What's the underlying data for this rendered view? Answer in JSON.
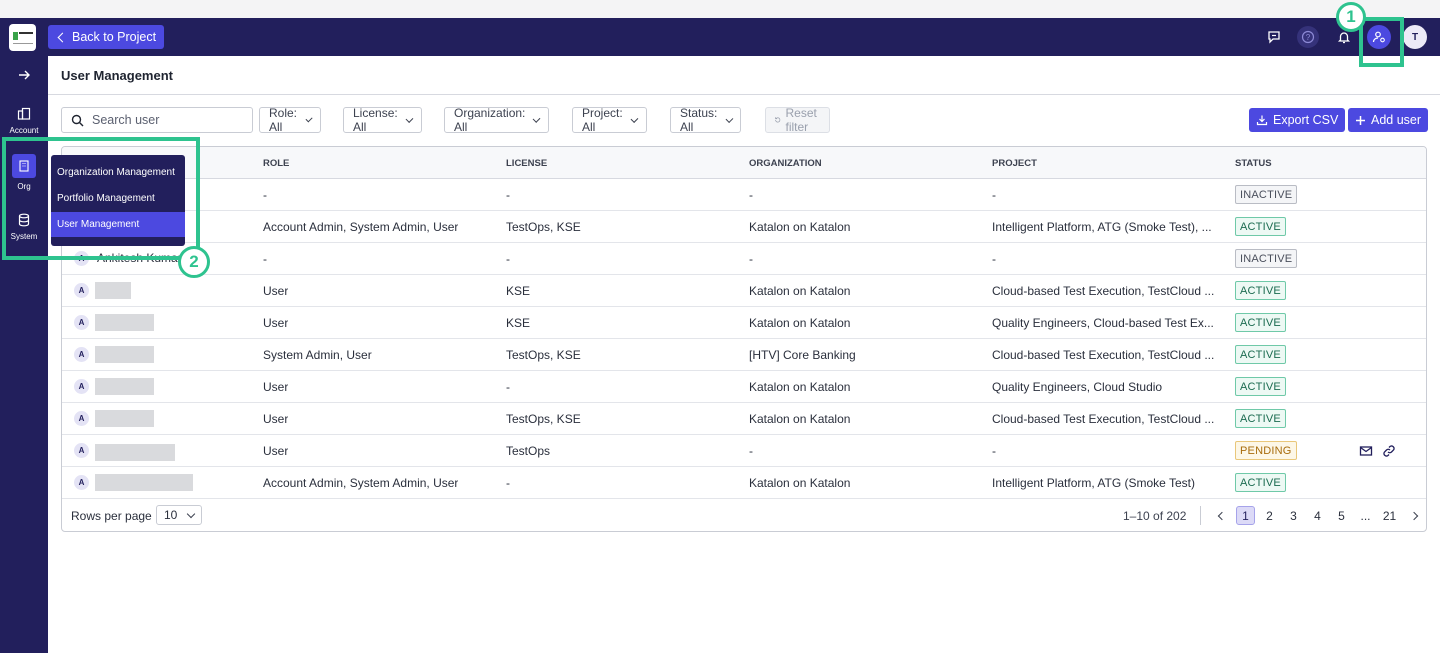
{
  "topbar": {
    "back_label": "Back to Project",
    "user_avatar_initial": "T"
  },
  "sidebar": {
    "items": [
      {
        "label": "Account"
      },
      {
        "label": "Org"
      },
      {
        "label": "System"
      }
    ]
  },
  "org_menu": {
    "items": [
      {
        "label": "Organization Management",
        "selected": false
      },
      {
        "label": "Portfolio Management",
        "selected": false
      },
      {
        "label": "User Management",
        "selected": true
      }
    ]
  },
  "page": {
    "title": "User Management"
  },
  "filters": {
    "search_placeholder": "Search user",
    "role": "Role: All",
    "license": "License: All",
    "organization": "Organization: All",
    "project": "Project: All",
    "status": "Status: All",
    "reset": "Reset filter"
  },
  "actions": {
    "export_label": "Export CSV",
    "add_user_label": "Add user"
  },
  "table": {
    "headers": [
      "ROLE",
      "LICENSE",
      "ORGANIZATION",
      "PROJECT",
      "STATUS"
    ],
    "rows": [
      {
        "avatar": "",
        "name": "",
        "role": "-",
        "license": "-",
        "organization": "-",
        "project": "-",
        "status": "INACTIVE"
      },
      {
        "avatar": "",
        "name": "",
        "role": "Account Admin, System Admin, User",
        "license": "TestOps, KSE",
        "organization": "Katalon on Katalon",
        "project": "Intelligent Platform, ATG (Smoke Test), ...",
        "status": "ACTIVE"
      },
      {
        "avatar": "A",
        "name": "Ankitesh Kumar",
        "role": "-",
        "license": "-",
        "organization": "-",
        "project": "-",
        "status": "INACTIVE"
      },
      {
        "avatar": "A",
        "name": "",
        "role": "User",
        "license": "KSE",
        "organization": "Katalon on Katalon",
        "project": "Cloud-based Test Execution, TestCloud ...",
        "status": "ACTIVE"
      },
      {
        "avatar": "A",
        "name": "",
        "role": "User",
        "license": "KSE",
        "organization": "Katalon on Katalon",
        "project": "Quality Engineers, Cloud-based Test Ex...",
        "status": "ACTIVE"
      },
      {
        "avatar": "A",
        "name": "",
        "role": "System Admin, User",
        "license": "TestOps, KSE",
        "organization": "[HTV] Core Banking",
        "project": "Cloud-based Test Execution, TestCloud ...",
        "status": "ACTIVE"
      },
      {
        "avatar": "A",
        "name": "",
        "role": "User",
        "license": "-",
        "organization": "Katalon on Katalon",
        "project": "Quality Engineers, Cloud Studio",
        "status": "ACTIVE"
      },
      {
        "avatar": "A",
        "name": "",
        "role": "User",
        "license": "TestOps, KSE",
        "organization": "Katalon on Katalon",
        "project": "Cloud-based Test Execution, TestCloud ...",
        "status": "ACTIVE"
      },
      {
        "avatar": "A",
        "name": "",
        "role": "User",
        "license": "TestOps",
        "organization": "-",
        "project": "-",
        "status": "PENDING"
      },
      {
        "avatar": "A",
        "name": "",
        "role": "Account Admin, System Admin, User",
        "license": "-",
        "organization": "Katalon on Katalon",
        "project": "Intelligent Platform, ATG (Smoke Test)",
        "status": "ACTIVE"
      }
    ]
  },
  "pagination": {
    "rows_per_page_label": "Rows per page",
    "rows_per_page_value": "10",
    "range_text": "1–10 of 202",
    "pages": [
      "1",
      "2",
      "3",
      "4",
      "5",
      "...",
      "21"
    ],
    "current_page": "1"
  },
  "annotations": {
    "callout_1": "1",
    "callout_2": "2",
    "highlight_color": "#2ec38f"
  },
  "colors": {
    "navy": "#221f5c",
    "accent": "#4c49e0",
    "active_green": "#1b6b50",
    "pending_amber": "#a86c0c"
  }
}
